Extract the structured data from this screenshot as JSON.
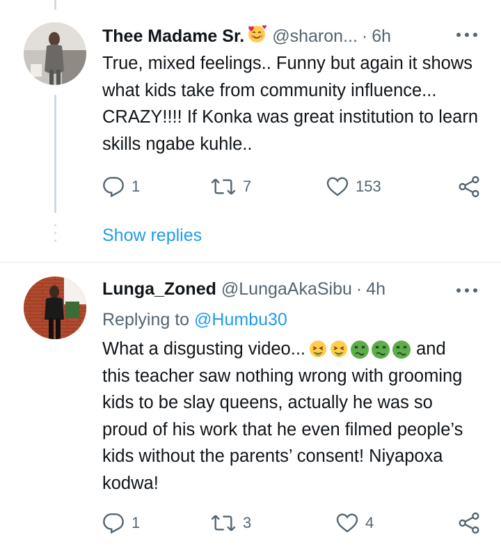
{
  "tweet1": {
    "name": "Thee Madame Sr.",
    "emoji": "smiling-face-with-hearts",
    "handle": "@sharon...",
    "sep": "·",
    "time": "6h",
    "text": "True, mixed feelings.. Funny but again it shows what kids take from community influence... CRAZY!!!! If Konka was great institution to learn skills ngabe kuhle..",
    "replies": "1",
    "retweets": "7",
    "likes": "153"
  },
  "show_replies": "Show replies",
  "tweet2": {
    "name": "Lunga_Zoned",
    "handle": "@LungaAkaSibu",
    "sep": "·",
    "time": "4h",
    "replying_prefix": "Replying to",
    "replying_to": "@Humbu30",
    "text_start": "What a disgusting video...",
    "emojis": [
      "face-vomiting",
      "face-vomiting",
      "nauseated-face",
      "nauseated-face",
      "nauseated-face"
    ],
    "text_rest": "and this teacher saw nothing wrong with grooming kids to be slay queens, actually he was so proud of his work that he even filmed people’s kids without the parents’ consent! Niyapoxa kodwa!",
    "replies": "1",
    "retweets": "3",
    "likes": "4"
  },
  "colors": {
    "link": "#1d9bf0",
    "secondary": "#536471",
    "text": "#0f1419",
    "line": "#cfd9de"
  }
}
